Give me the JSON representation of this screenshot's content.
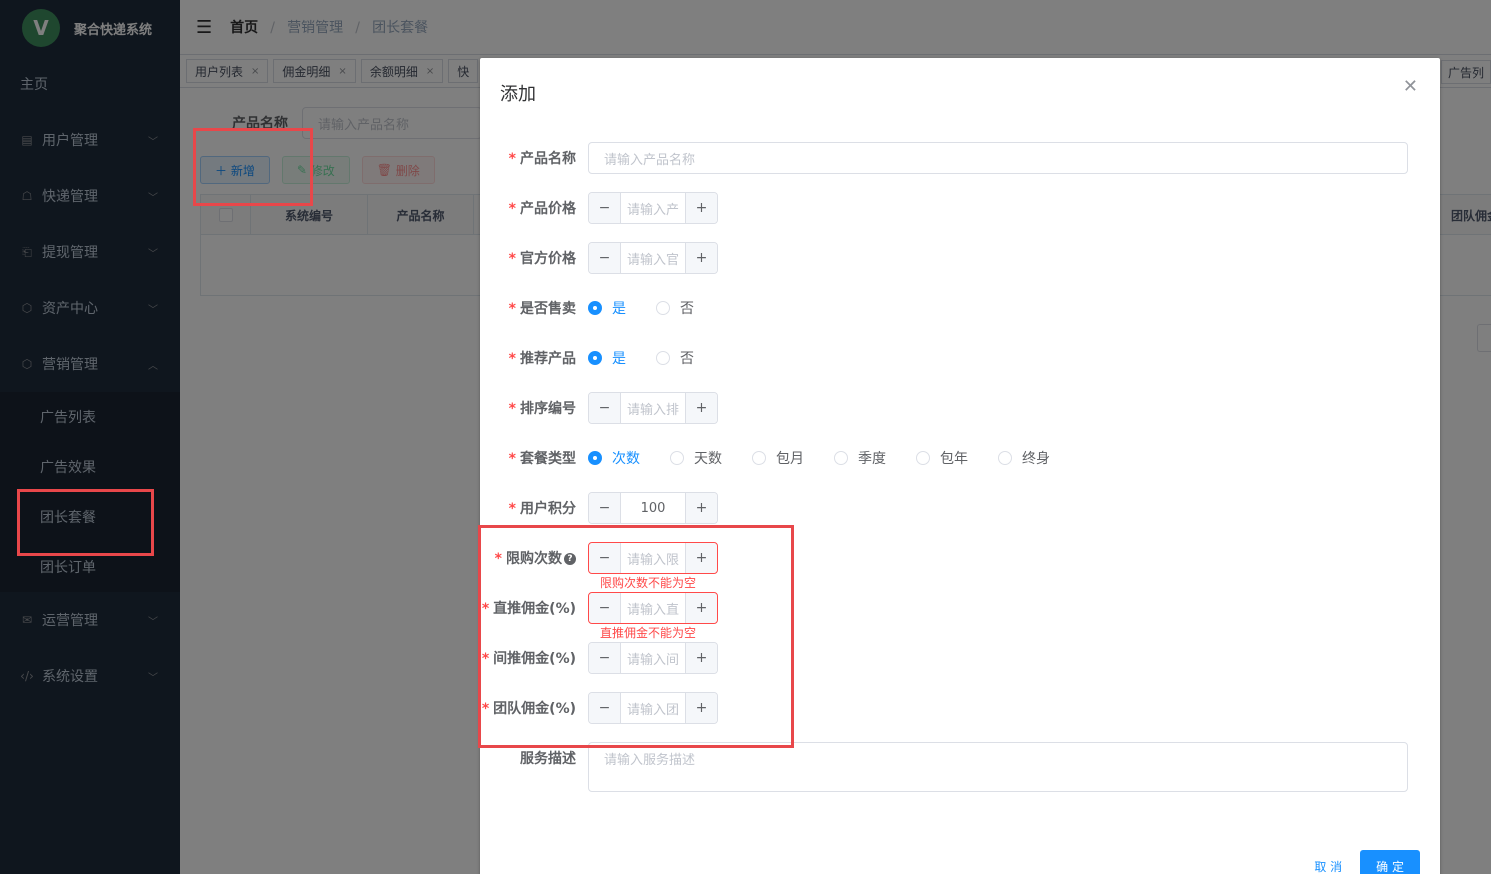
{
  "app": {
    "title": "聚合快递系统",
    "logo_letter": "V"
  },
  "sidebar": {
    "home": "主页",
    "items": [
      {
        "label": "用户管理",
        "icon": "list-icon"
      },
      {
        "label": "快递管理",
        "icon": "chat-icon"
      },
      {
        "label": "提现管理",
        "icon": "wallet-icon"
      },
      {
        "label": "资产中心",
        "icon": "box-icon"
      },
      {
        "label": "营销管理",
        "icon": "box-icon"
      }
    ],
    "sub_items": [
      "广告列表",
      "广告效果",
      "团长套餐",
      "团长订单"
    ],
    "items_after": [
      {
        "label": "运营管理",
        "icon": "mail-icon"
      },
      {
        "label": "系统设置",
        "icon": "code-icon"
      }
    ]
  },
  "breadcrumb": {
    "home": "首页",
    "parent": "营销管理",
    "current": "团长套餐"
  },
  "tags": [
    "用户列表",
    "佣金明细",
    "余额明细",
    "快"
  ],
  "tag_right": "广告列",
  "page": {
    "search_label": "产品名称",
    "search_placeholder": "请输入产品名称",
    "btn_add": "新增",
    "btn_edit": "修改",
    "btn_delete": "删除",
    "columns": [
      "系统编号",
      "产品名称"
    ],
    "column_right": "团队佣金"
  },
  "dialog": {
    "title": "添加",
    "fields": {
      "name": {
        "label": "产品名称",
        "placeholder": "请输入产品名称"
      },
      "price": {
        "label": "产品价格",
        "placeholder": "请输入产"
      },
      "official_price": {
        "label": "官方价格",
        "placeholder": "请输入官"
      },
      "on_sale": {
        "label": "是否售卖",
        "options": [
          "是",
          "否"
        ],
        "selected": "是"
      },
      "recommend": {
        "label": "推荐产品",
        "options": [
          "是",
          "否"
        ],
        "selected": "是"
      },
      "sort": {
        "label": "排序编号",
        "placeholder": "请输入排"
      },
      "package_type": {
        "label": "套餐类型",
        "options": [
          "次数",
          "天数",
          "包月",
          "季度",
          "包年",
          "终身"
        ],
        "selected": "次数"
      },
      "points": {
        "label": "用户积分",
        "value": "100"
      },
      "limit": {
        "label": "限购次数",
        "placeholder": "请输入限",
        "error": "限购次数不能为空"
      },
      "direct": {
        "label": "直推佣金(%)",
        "placeholder": "请输入直",
        "error": "直推佣金不能为空"
      },
      "indirect": {
        "label": "间推佣金(%)",
        "placeholder": "请输入间"
      },
      "team": {
        "label": "团队佣金(%)",
        "placeholder": "请输入团"
      },
      "desc": {
        "label": "服务描述",
        "placeholder": "请输入服务描述"
      }
    },
    "cancel": "取 消",
    "confirm": "确 定"
  },
  "colors": {
    "primary": "#1890ff",
    "sidebar": "#1f2d3d",
    "error": "#ff4949",
    "annotation": "#e8474a"
  }
}
